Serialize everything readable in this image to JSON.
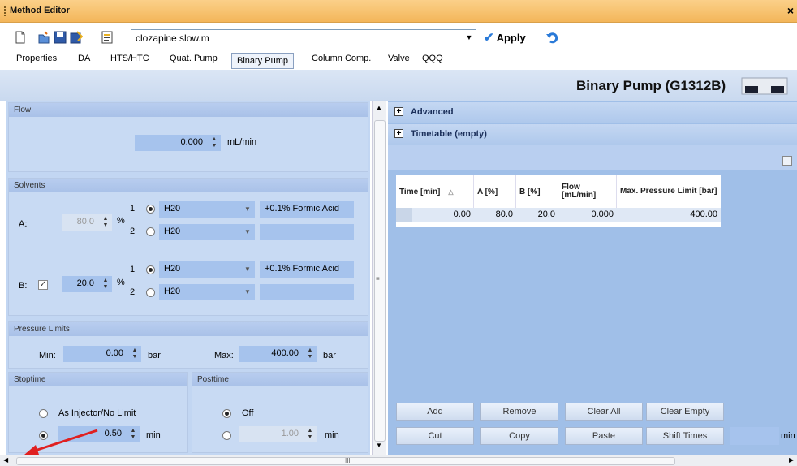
{
  "window": {
    "title": "Method Editor",
    "close": "×"
  },
  "toolbar": {
    "method_file": "clozapine slow.m",
    "apply_label": "Apply"
  },
  "tabs": [
    "Properties",
    "DA",
    "HTS/HTC",
    "Quat. Pump",
    "Binary Pump",
    "Column Comp.",
    "Valve",
    "QQQ"
  ],
  "selected_tab": "Binary Pump",
  "header": {
    "title": "Binary Pump (G1312B)"
  },
  "flow": {
    "title": "Flow",
    "value": "0.000",
    "unit": "mL/min"
  },
  "solvents": {
    "title": "Solvents",
    "a": {
      "label": "A:",
      "percent": "80.0",
      "percent_unit": "%",
      "ch1": {
        "num": "1",
        "solvent": "H20",
        "comment": "+0.1% Formic Acid"
      },
      "ch2": {
        "num": "2",
        "solvent": "H20",
        "comment": ""
      }
    },
    "b": {
      "label": "B:",
      "percent": "20.0",
      "percent_unit": "%",
      "ch1": {
        "num": "1",
        "solvent": "H20",
        "comment": "+0.1% Formic Acid"
      },
      "ch2": {
        "num": "2",
        "solvent": "H20",
        "comment": ""
      }
    }
  },
  "pressure": {
    "title": "Pressure Limits",
    "min_label": "Min:",
    "min_value": "0.00",
    "max_label": "Max:",
    "max_value": "400.00",
    "unit": "bar"
  },
  "stoptime": {
    "title": "Stoptime",
    "option1": "As Injector/No Limit",
    "value": "0.50",
    "unit": "min"
  },
  "posttime": {
    "title": "Posttime",
    "option1": "Off",
    "value": "1.00",
    "unit": "min"
  },
  "sections": {
    "advanced": "Advanced",
    "timetable": "Timetable (empty)"
  },
  "timetable": {
    "columns": [
      "Time [min]",
      "A [%]",
      "B [%]",
      "Flow [mL/min]",
      "Max. Pressure Limit [bar]"
    ],
    "rows": [
      [
        "0.00",
        "80.0",
        "20.0",
        "0.000",
        "400.00"
      ]
    ]
  },
  "buttons": {
    "row1": [
      "Add",
      "Remove",
      "Clear All",
      "Clear Empty"
    ],
    "row2": [
      "Cut",
      "Copy",
      "Paste",
      "Shift Times"
    ],
    "shift_unit": "min"
  },
  "scroll_grip": "III",
  "colors": {
    "title_bar": "#f3b65a",
    "panel": "#c2d6f2",
    "input": "#a6c3ed",
    "arrow": "#e02020"
  }
}
